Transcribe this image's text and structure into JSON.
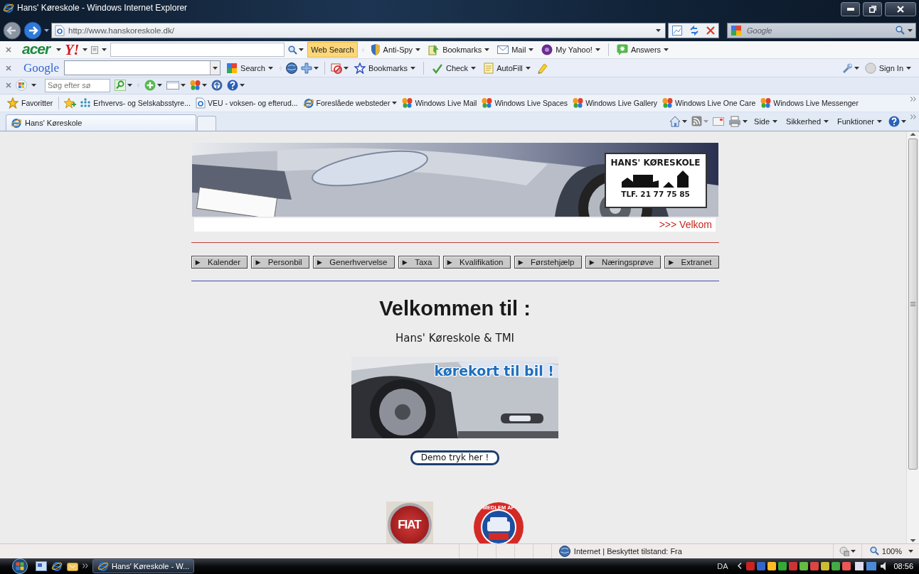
{
  "window": {
    "title": "Hans' Køreskole - Windows Internet Explorer"
  },
  "address_bar": {
    "url": "http://www.hanskoreskole.dk/",
    "search_placeholder": "Google"
  },
  "acer_toolbar": {
    "brand": "acer",
    "yahoo_logo": "Y!",
    "search_button": "Web Search",
    "buttons": [
      {
        "kind": "shield",
        "label": "Anti-Spy"
      },
      {
        "kind": "bookmark",
        "label": "Bookmarks"
      },
      {
        "kind": "mail",
        "label": "Mail"
      },
      {
        "kind": "profile",
        "label": "My Yahoo!"
      },
      {
        "kind": "answers",
        "label": "Answers"
      }
    ]
  },
  "google_toolbar": {
    "logo": "Google",
    "buttons": [
      {
        "kind": "search",
        "label": "Search"
      },
      {
        "kind": "bookmarks",
        "label": "Bookmarks"
      },
      {
        "kind": "check",
        "label": "Check"
      },
      {
        "kind": "autofill",
        "label": "AutoFill"
      }
    ],
    "sign_in": "Sign In"
  },
  "live_toolbar": {
    "search_placeholder": "Søg efter sø"
  },
  "favorites_bar": {
    "label": "Favoritter",
    "links": [
      {
        "kind": "site",
        "label": "Erhvervs- og Selskabsstyre..."
      },
      {
        "kind": "page",
        "label": "VEU - voksen- og efterud..."
      },
      {
        "kind": "menu",
        "label": "Foreslåede websteder"
      },
      {
        "kind": "live",
        "label": "Windows Live Mail"
      },
      {
        "kind": "live",
        "label": "Windows Live Spaces"
      },
      {
        "kind": "live",
        "label": "Windows Live Gallery"
      },
      {
        "kind": "live",
        "label": "Windows Live One Care"
      },
      {
        "kind": "live",
        "label": "Windows Live Messenger"
      }
    ]
  },
  "tabs": [
    {
      "label": "Hans' Køreskole",
      "selected": true
    }
  ],
  "command_bar": {
    "menus": [
      "Side",
      "Sikkerhed",
      "Funktioner"
    ]
  },
  "page": {
    "logo": {
      "name": "HANS' KØRESKOLE",
      "phone": "TLF. 21 77 75 85"
    },
    "marquee": ">>> Velkom",
    "menu": [
      {
        "marker": "►",
        "label": "Kalender"
      },
      {
        "marker": "►",
        "label": "Personbil"
      },
      {
        "marker": "►",
        "label": "Generhvervelse"
      },
      {
        "marker": "►",
        "label": "Taxa"
      },
      {
        "marker": "►",
        "label": "Kvalifikation"
      },
      {
        "marker": "►",
        "label": "Førstehjælp"
      },
      {
        "marker": "►",
        "label": "Næringsprøve"
      },
      {
        "marker": "►",
        "label": "Extranet"
      }
    ],
    "heading": "Velkommen til :",
    "subheading": "Hans' Køreskole & TMI",
    "promo_caption": "kørekort til bil !",
    "demo_button": "Demo tryk her !",
    "sponsors": [
      {
        "kind": "fiat",
        "label": "FIAT"
      },
      {
        "kind": "club",
        "label": "MEDLEM AF"
      }
    ]
  },
  "status_bar": {
    "zone": "Internet | Beskyttet tilstand: Fra",
    "zoom": "100%"
  },
  "taskbar": {
    "tasks": [
      {
        "label": "Hans' Køreskole - W...",
        "selected": true
      }
    ],
    "language": "DA",
    "clock": "08:56"
  }
}
